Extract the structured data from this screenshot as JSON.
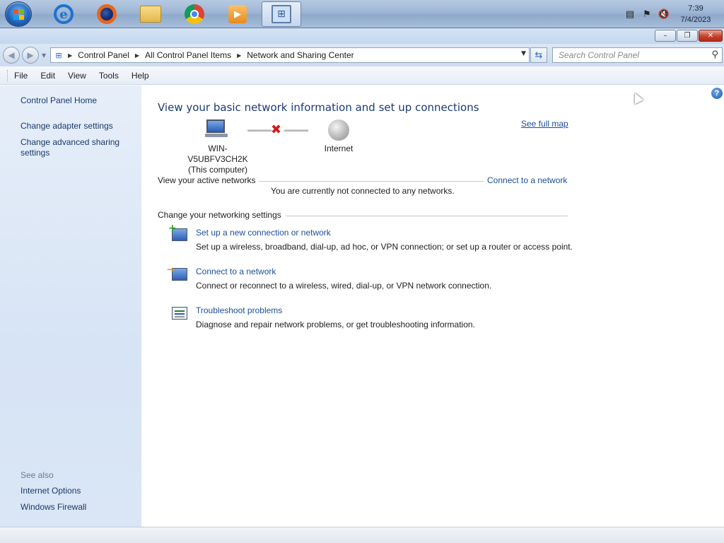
{
  "taskbar": {
    "apps": [
      {
        "name": "internet-explorer",
        "glyph": "e"
      },
      {
        "name": "firefox"
      },
      {
        "name": "file-explorer"
      },
      {
        "name": "chrome"
      },
      {
        "name": "media-player",
        "glyph": "▶"
      },
      {
        "name": "control-panel",
        "glyph": "⊞",
        "active": true
      }
    ],
    "tray_icons": [
      "network-disconnected-icon",
      "action-center-icon",
      "volume-muted-icon"
    ],
    "clock_time": "7:39",
    "clock_date": "7/4/2023"
  },
  "window_buttons": {
    "minimize": "–",
    "restore": "❐",
    "close": "✕"
  },
  "navigation": {
    "back_glyph": "◀",
    "forward_glyph": "▶",
    "breadcrumbs": [
      "Control Panel",
      "All Control Panel Items",
      "Network and Sharing Center"
    ],
    "search_placeholder": "Search Control Panel"
  },
  "menubar": [
    "File",
    "Edit",
    "View",
    "Tools",
    "Help"
  ],
  "sidebar": {
    "home": "Control Panel Home",
    "links": [
      "Change adapter settings",
      "Change advanced sharing settings"
    ],
    "see_also_label": "See also",
    "see_also": [
      "Internet Options",
      "Windows Firewall"
    ]
  },
  "main": {
    "heading": "View your basic network information and set up connections",
    "see_full_map": "See full map",
    "computer_name": "WIN-V5UBFV3CH2K",
    "computer_sub": "(This computer)",
    "internet_label": "Internet",
    "active_networks_label": "View your active networks",
    "connect_link": "Connect to a network",
    "status_text": "You are currently not connected to any networks.",
    "settings_label": "Change your networking settings",
    "tasks": [
      {
        "title": "Set up a new connection or network",
        "desc": "Set up a wireless, broadband, dial-up, ad hoc, or VPN connection; or set up a router or access point.",
        "icon": "new-connection-icon"
      },
      {
        "title": "Connect to a network",
        "desc": "Connect or reconnect to a wireless, wired, dial-up, or VPN network connection.",
        "icon": "connect-network-icon"
      },
      {
        "title": "Troubleshoot problems",
        "desc": "Diagnose and repair network problems, or get troubleshooting information.",
        "icon": "troubleshoot-icon"
      }
    ]
  },
  "colors": {
    "link": "#1b4f99",
    "heading": "#1a3a73",
    "sidebar": "#dae6f5",
    "disconnect": "#d01b1b"
  }
}
